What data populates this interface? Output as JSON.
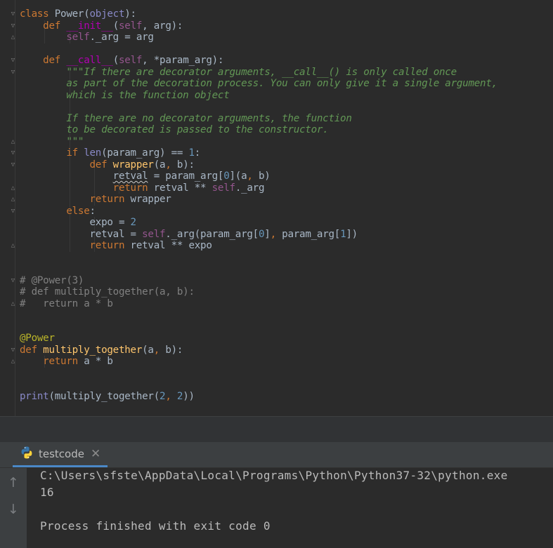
{
  "code_lines": [
    [
      {
        "t": "class ",
        "c": "kw"
      },
      {
        "t": "Power("
      },
      {
        "t": "object",
        "c": "pm"
      },
      {
        "t": "):"
      }
    ],
    [
      {
        "t": "    "
      },
      {
        "t": "def ",
        "c": "kw"
      },
      {
        "t": "__init__",
        "c": "mg"
      },
      {
        "t": "("
      },
      {
        "t": "self",
        "c": "sf"
      },
      {
        "t": ", arg):"
      }
    ],
    [
      {
        "t": "        "
      },
      {
        "t": "self",
        "c": "sf"
      },
      {
        "t": "._arg = arg"
      }
    ],
    [],
    [
      {
        "t": "    "
      },
      {
        "t": "def ",
        "c": "kw"
      },
      {
        "t": "__call__",
        "c": "mg"
      },
      {
        "t": "("
      },
      {
        "t": "self",
        "c": "sf"
      },
      {
        "t": ", *param_arg):"
      }
    ],
    [
      {
        "t": "        "
      },
      {
        "t": "\"\"\"If there are decorator arguments, __call__() is only called once",
        "c": "dc"
      }
    ],
    [
      {
        "t": "        "
      },
      {
        "t": "as part of the decoration process. You can only give it a single argument,",
        "c": "dc"
      }
    ],
    [
      {
        "t": "        "
      },
      {
        "t": "which is the function object",
        "c": "dc"
      }
    ],
    [],
    [
      {
        "t": "        "
      },
      {
        "t": "If there are no decorator arguments, the function",
        "c": "dc"
      }
    ],
    [
      {
        "t": "        "
      },
      {
        "t": "to be decorated is passed to the constructor.",
        "c": "dc"
      }
    ],
    [
      {
        "t": "        "
      },
      {
        "t": "\"\"\"",
        "c": "dc"
      }
    ],
    [
      {
        "t": "        "
      },
      {
        "t": "if ",
        "c": "kw"
      },
      {
        "t": "len",
        "c": "pm"
      },
      {
        "t": "(param_arg) == "
      },
      {
        "t": "1",
        "c": "nm"
      },
      {
        "t": ":"
      }
    ],
    [
      {
        "t": "            "
      },
      {
        "t": "def ",
        "c": "kw"
      },
      {
        "t": "wrapper",
        "c": "fn"
      },
      {
        "t": "(a"
      },
      {
        "t": ", ",
        "c": "kw"
      },
      {
        "t": "b):"
      }
    ],
    [
      {
        "t": "                "
      },
      {
        "t": "retval",
        "c": "squig"
      },
      {
        "t": " = param_arg["
      },
      {
        "t": "0",
        "c": "nm"
      },
      {
        "t": "](a"
      },
      {
        "t": ", ",
        "c": "kw"
      },
      {
        "t": "b)"
      }
    ],
    [
      {
        "t": "                "
      },
      {
        "t": "return ",
        "c": "kw"
      },
      {
        "t": "retval ** "
      },
      {
        "t": "self",
        "c": "sf"
      },
      {
        "t": "._arg"
      }
    ],
    [
      {
        "t": "            "
      },
      {
        "t": "return ",
        "c": "kw"
      },
      {
        "t": "wrapper"
      }
    ],
    [
      {
        "t": "        "
      },
      {
        "t": "else",
        "c": "kw"
      },
      {
        "t": ":"
      }
    ],
    [
      {
        "t": "            "
      },
      {
        "t": "expo = "
      },
      {
        "t": "2",
        "c": "nm"
      }
    ],
    [
      {
        "t": "            "
      },
      {
        "t": "retval = "
      },
      {
        "t": "self",
        "c": "sf"
      },
      {
        "t": "._arg(param_arg["
      },
      {
        "t": "0",
        "c": "nm"
      },
      {
        "t": "]"
      },
      {
        "t": ", ",
        "c": "kw"
      },
      {
        "t": "param_arg["
      },
      {
        "t": "1",
        "c": "nm"
      },
      {
        "t": "])"
      }
    ],
    [
      {
        "t": "            "
      },
      {
        "t": "return ",
        "c": "kw"
      },
      {
        "t": "retval ** expo"
      }
    ],
    [],
    [],
    [
      {
        "t": "# @Power(3)",
        "c": "cm"
      }
    ],
    [
      {
        "t": "# def multiply_together(a, b):",
        "c": "cm"
      }
    ],
    [
      {
        "t": "#   return a * b",
        "c": "cm"
      }
    ],
    [],
    [],
    [
      {
        "t": "@Power",
        "c": "dec"
      }
    ],
    [
      {
        "t": "def ",
        "c": "kw"
      },
      {
        "t": "multiply_together",
        "c": "fn"
      },
      {
        "t": "(a"
      },
      {
        "t": ", ",
        "c": "kw"
      },
      {
        "t": "b):"
      }
    ],
    [
      {
        "t": "    "
      },
      {
        "t": "return ",
        "c": "kw"
      },
      {
        "t": "a * b"
      }
    ],
    [],
    [],
    [
      {
        "t": "print",
        "c": "pm"
      },
      {
        "t": "(multiply_together("
      },
      {
        "t": "2",
        "c": "nm"
      },
      {
        "t": ", ",
        "c": "kw"
      },
      {
        "t": "2",
        "c": "nm"
      },
      {
        "t": "))"
      }
    ]
  ],
  "run_tab": {
    "label": "testcode",
    "close_glyph": "✕"
  },
  "console": {
    "lines": [
      "C:\\Users\\sfste\\AppData\\Local\\Programs\\Python\\Python37-32\\python.exe",
      "16",
      "",
      "Process finished with exit code 0"
    ],
    "up_glyph": "↑",
    "down_glyph": "↓"
  },
  "icons": {
    "python": "python-icon",
    "up": "arrow-up-icon",
    "down": "arrow-down-icon",
    "close": "close-icon"
  },
  "colors": {
    "background": "#2b2b2b",
    "keyword": "#cc7832",
    "self": "#94558d",
    "number": "#6897bb",
    "function": "#ffc66d",
    "comment": "#808080",
    "docstring": "#629755",
    "decorator": "#bbb529",
    "builtin": "#8888c6",
    "magic": "#b200b2",
    "tab_underline": "#4a88c7"
  }
}
